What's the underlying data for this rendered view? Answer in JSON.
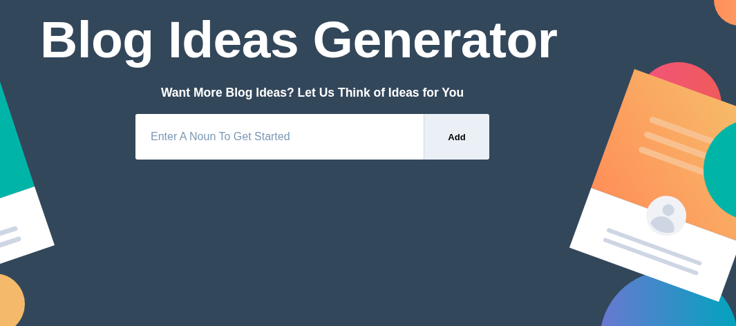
{
  "title": "Blog Ideas Generator",
  "subtitle": "Want More Blog Ideas? Let Us Think of Ideas for You",
  "search": {
    "placeholder": "Enter A Noun To Get Started"
  },
  "button": {
    "label": "Add"
  }
}
